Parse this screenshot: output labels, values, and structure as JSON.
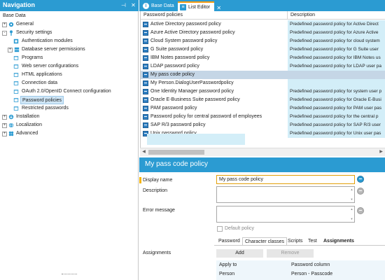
{
  "navigation": {
    "title": "Navigation",
    "root_label": "Base Data",
    "items": [
      {
        "label": "General",
        "expander": "+",
        "icon": "gear-icon"
      },
      {
        "label": "Security settings",
        "expander": "-",
        "icon": "key-icon"
      },
      {
        "label": "Authentication modules",
        "icon": "module-icon"
      },
      {
        "label": "Database server permissions",
        "expander": "+",
        "icon": "server-icon"
      },
      {
        "label": "Programs",
        "icon": "program-icon"
      },
      {
        "label": "Web server configurations",
        "icon": "web-icon"
      },
      {
        "label": "HTML applications",
        "icon": "html-icon"
      },
      {
        "label": "Connection data",
        "icon": "connection-icon"
      },
      {
        "label": "OAuth 2.0/OpenID Connect configuration",
        "icon": "oauth-icon"
      },
      {
        "label": "Password policies",
        "icon": "password-policy-icon"
      },
      {
        "label": "Restricted passwords",
        "icon": "restricted-icon"
      },
      {
        "label": "Installation",
        "expander": "+",
        "icon": "installation-icon"
      },
      {
        "label": "Localization",
        "expander": "+",
        "icon": "globe-icon"
      },
      {
        "label": "Advanced",
        "expander": "+",
        "icon": "advanced-icon"
      }
    ]
  },
  "tabs": [
    {
      "label": "Base Data",
      "icon": "i"
    },
    {
      "label": "List Editor",
      "icon": "≡",
      "close": "✕"
    }
  ],
  "list": {
    "columns": [
      "Password policies",
      "Description"
    ],
    "rows": [
      {
        "name": "Active Directory password policy",
        "description": "Predefined password policy for Active Direct"
      },
      {
        "name": "Azure Active Directory password policy",
        "description": "Predefined password policy for Azure Active"
      },
      {
        "name": "Cloud System password policy",
        "description": "Predefined password policy for cloud system"
      },
      {
        "name": "G Suite password policy",
        "description": "Predefined password policy for G Suite user"
      },
      {
        "name": "IBM Notes password policy",
        "description": "Predefined password policy for IBM Notes us"
      },
      {
        "name": "LDAP password policy",
        "description": "Predefined password policy for LDAP user pa"
      },
      {
        "name": "My pass code policy",
        "description": ""
      },
      {
        "name": "My Person.DialogUserPasswordpolicy",
        "description": ""
      },
      {
        "name": "One Identity Manager password policy",
        "description": "Predefined password policy for system user p"
      },
      {
        "name": "Oracle E-Business Suite password policy",
        "description": "Predefined password policy for Oracle E-Busi"
      },
      {
        "name": "PAM password policy",
        "description": "Predefined password policy for PAM user pas"
      },
      {
        "name": "Password policy for central password of employees",
        "description": "Predefined password policy for the central p"
      },
      {
        "name": "SAP R/3 password policy",
        "description": "Predefined password policy for SAP R/3 user"
      },
      {
        "name": "Unix password policy",
        "description": "Predefined password policy for Unix user pas"
      }
    ],
    "selected_index": 6
  },
  "detail": {
    "title": "My pass code policy",
    "display_name_label": "Display name",
    "display_name_value": "My pass code policy",
    "description_label": "Description",
    "description_value": "",
    "error_message_label": "Error message",
    "error_message_value": "",
    "default_policy_label": "Default policy",
    "sub_tabs": [
      "Password",
      "Character classes",
      "Scripts",
      "Test",
      "Assignments"
    ],
    "active_sub_tab": "Assignments",
    "assignments_label": "Assignments",
    "add_label": "Add",
    "remove_label": "Remove",
    "assign_columns": [
      "Apply to",
      "Password column"
    ],
    "assign_rows": [
      {
        "apply_to": "Person",
        "column": "Person - Passcode"
      }
    ]
  },
  "colors": {
    "accent": "#2b9bd2",
    "selected_row": "#c5d6e6",
    "description_fill": "#d3eef8",
    "tab_indicator": "#f39c12"
  }
}
